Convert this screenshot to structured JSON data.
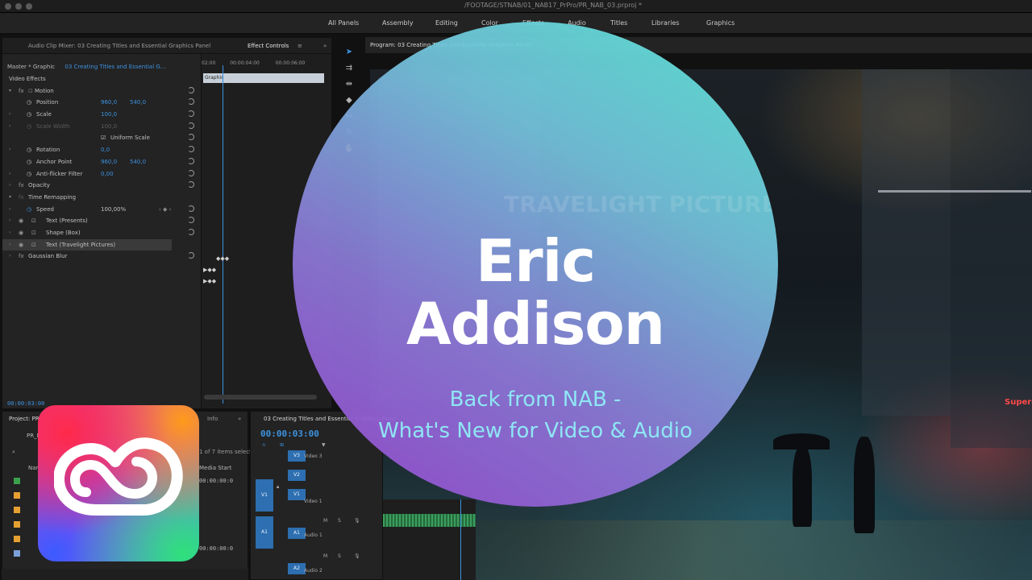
{
  "window": {
    "path": "/FOOTAGE/STNAB/01_NAB17_PrPro/PR_NAB_03.prproj *"
  },
  "workspaces": [
    "All Panels",
    "Assembly",
    "Editing",
    "Color",
    "Effects",
    "Audio",
    "Titles",
    "Libraries",
    "Graphics"
  ],
  "effect_panel": {
    "tab_mixer": "Audio Clip Mixer: 03 Creating Titles and Essential Graphics Panel",
    "tab_effect_controls": "Effect Controls",
    "master_label": "Master * Graphic",
    "sequence_label": "03 Creating Titles and Essential G...",
    "section_video_effects": "Video Effects",
    "rows": [
      {
        "label": "Motion",
        "v1": "",
        "v2": ""
      },
      {
        "label": "Position",
        "v1": "960,0",
        "v2": "540,0"
      },
      {
        "label": "Scale",
        "v1": "100,0",
        "v2": ""
      },
      {
        "label": "Scale Width",
        "v1": "100,0",
        "v2": ""
      },
      {
        "label": "Uniform Scale",
        "v1": "",
        "v2": ""
      },
      {
        "label": "Rotation",
        "v1": "0,0",
        "v2": ""
      },
      {
        "label": "Anchor Point",
        "v1": "960,0",
        "v2": "540,0"
      },
      {
        "label": "Anti-flicker Filter",
        "v1": "0,00",
        "v2": ""
      },
      {
        "label": "Opacity",
        "v1": "",
        "v2": ""
      },
      {
        "label": "Time Remapping",
        "v1": "",
        "v2": ""
      },
      {
        "label": "Speed",
        "v1": "100,00%",
        "v2": ""
      },
      {
        "label": "Text (Presents)",
        "v1": "",
        "v2": ""
      },
      {
        "label": "Shape (Box)",
        "v1": "",
        "v2": ""
      },
      {
        "label": "Text (Travelight Pictures)",
        "v1": "",
        "v2": ""
      },
      {
        "label": "Gaussian Blur",
        "v1": "",
        "v2": ""
      }
    ],
    "ruler": [
      "02:00",
      "00:00:04:00",
      "00:00:06:00"
    ],
    "clip_label": "Graphic",
    "timecode": "00:00:03:00"
  },
  "program": {
    "title": "Program: 03 Creating Titles and Essential Graphics Panel",
    "sign_text": "Superdry"
  },
  "project": {
    "tab": "Project: PR_NAB_03",
    "info_tab": "Info",
    "bin": "PR_NAB_03.prproj",
    "items_selected": "1 of 7 items selected",
    "col_name": "Name",
    "col_media_start": "Media Start",
    "media_start_1": "00:00:00:0",
    "media_start_2": "00:00:00:0"
  },
  "timeline": {
    "sequence": "03 Creating Titles and Essential Graphics Panel",
    "timecode": "00:00:03:00",
    "tracks": [
      {
        "tag": "V3",
        "name": "Video 3"
      },
      {
        "tag": "V2",
        "name": ""
      },
      {
        "tag": "V1",
        "name": "Video 1"
      },
      {
        "tag": "A1",
        "name": "Audio 1"
      },
      {
        "tag": "A2",
        "name": "Audio 2"
      }
    ]
  },
  "overlay": {
    "name_line1": "Eric",
    "name_line2": "Addison",
    "subtitle_line1": "Back from NAB -",
    "subtitle_line2": "What's New for  Video & Audio",
    "ghost_text": "TRAVELIGHT PICTURES"
  },
  "logo": {
    "name": "adobe-creative-cloud-icon"
  },
  "colors": {
    "accent_blue": "#3d92e0",
    "circle_top": "#5ae8d7",
    "circle_bottom": "#9646cd",
    "subtitle": "#8fe6f5"
  }
}
